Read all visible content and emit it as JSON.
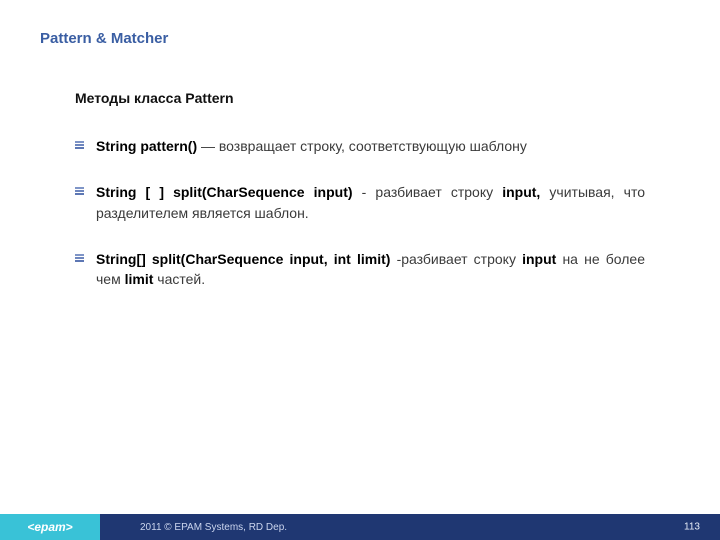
{
  "title": "Pattern & Matcher",
  "section_heading": "Методы класса Pattern",
  "bullets": [
    {
      "signature": "String pattern()",
      "description": " — возвращает строку, соответствующую шаблону"
    },
    {
      "signature": "String [ ] split(CharSequence input)",
      "mid1": " - разбивает строку ",
      "bold1": "input,",
      "tail": " учитывая, что разделителем является шаблон."
    },
    {
      "signature": "String[] split(CharSequence input, int limit)",
      "mid1": " -разбивает строку ",
      "bold1": "input",
      "mid2": " на не более чем ",
      "bold2": "limit",
      "tail": " частей."
    }
  ],
  "footer": {
    "brand": "<epam>",
    "copyright": "2011 © EPAM Systems, RD Dep.",
    "page": "113"
  }
}
